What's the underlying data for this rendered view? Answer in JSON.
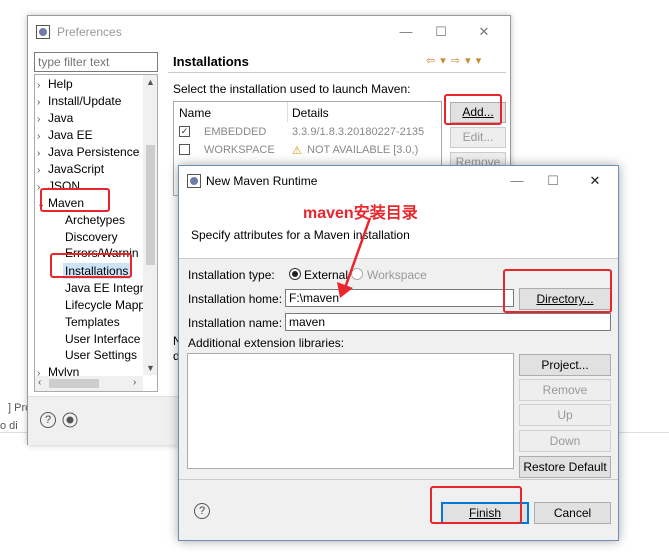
{
  "background": {
    "text_top": "] Pro",
    "text_bottom": "o di"
  },
  "preferences": {
    "title": "Preferences",
    "filter_placeholder": "type filter text",
    "tree": [
      {
        "label": "Help",
        "arrow": "›"
      },
      {
        "label": "Install/Update",
        "arrow": "›"
      },
      {
        "label": "Java",
        "arrow": "›"
      },
      {
        "label": "Java EE",
        "arrow": "›"
      },
      {
        "label": "Java Persistence",
        "arrow": "›"
      },
      {
        "label": "JavaScript",
        "arrow": "›"
      },
      {
        "label": "JSON",
        "arrow": "›"
      },
      {
        "label": "Maven",
        "arrow": "⌄"
      },
      {
        "label": "Archetypes",
        "arrow": ""
      },
      {
        "label": "Discovery",
        "arrow": ""
      },
      {
        "label": "Errors/Warnin",
        "arrow": ""
      },
      {
        "label": "Installations",
        "arrow": ""
      },
      {
        "label": "Java EE Integra",
        "arrow": ""
      },
      {
        "label": "Lifecycle Mapp",
        "arrow": ""
      },
      {
        "label": "Templates",
        "arrow": ""
      },
      {
        "label": "User Interface",
        "arrow": ""
      },
      {
        "label": "User Settings",
        "arrow": ""
      },
      {
        "label": "Mylyn",
        "arrow": "›"
      }
    ],
    "page_title": "Installations",
    "nav_icons": "⇦ ▾ ⇨ ▾ ▾",
    "select_label": "Select the installation used to launch Maven:",
    "table": {
      "headers": [
        "Name",
        "Details"
      ],
      "rows": [
        {
          "checked": true,
          "name": "EMBEDDED",
          "details": "3.3.9/1.8.3.20180227-2135"
        },
        {
          "checked": false,
          "name": "WORKSPACE",
          "details": "NOT AVAILABLE [3.0,)"
        }
      ]
    },
    "buttons": {
      "add": "Add...",
      "edit": "Edit...",
      "remove": "Remove"
    },
    "n_text": "N",
    "d_text": "d",
    "help": "?"
  },
  "dialog": {
    "title": "New Maven Runtime",
    "annotation": "maven安装目录",
    "description": "Specify attributes for a Maven installation",
    "installation_type_label": "Installation type:",
    "type_options": [
      "External",
      "Workspace"
    ],
    "installation_home_label": "Installation home:",
    "installation_home_value": "F:\\maven",
    "installation_name_label": "Installation name:",
    "installation_name_value": "maven",
    "directory_button": "Directory...",
    "ext_label": "Additional extension libraries:",
    "side_buttons": [
      "Project...",
      "Remove",
      "Up",
      "Down",
      "Restore Default"
    ],
    "finish": "Finish",
    "cancel": "Cancel",
    "help": "?"
  },
  "colors": {
    "annotation": "#e8262c",
    "selection": "#cce4f7",
    "default_button": "#0078d7"
  }
}
